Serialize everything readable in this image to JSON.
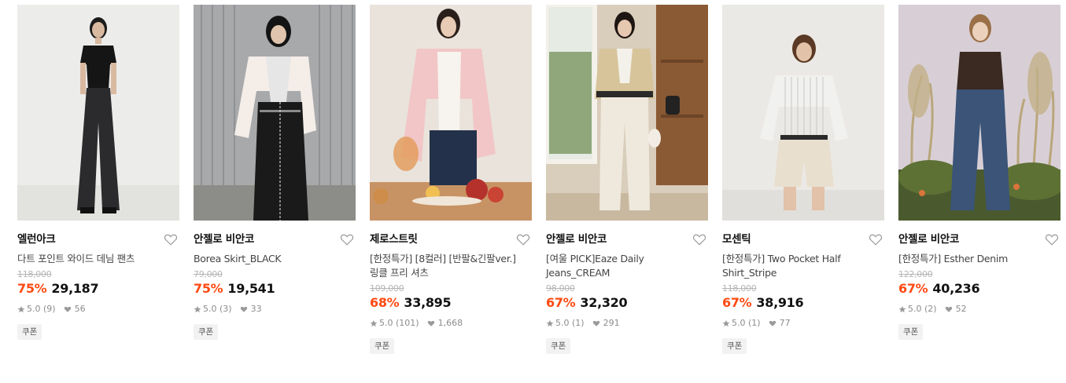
{
  "colors": {
    "discount": "#ff4a12",
    "price": "#111111",
    "muted": "#8c8c8c",
    "coupon_bg": "#f2f2f2"
  },
  "products": [
    {
      "brand": "엘런아크",
      "name": "다트 포인트 와이드 데님 팬츠",
      "original_price": "118,000",
      "discount": "75%",
      "price": "29,187",
      "rating": "5.0 (9)",
      "likes": "56",
      "badge": "쿠폰",
      "heart_icon": "heart-outline-icon"
    },
    {
      "brand": "안젤로 비안코",
      "name": "Borea Skirt_BLACK",
      "original_price": "79,000",
      "discount": "75%",
      "price": "19,541",
      "rating": "5.0 (3)",
      "likes": "33",
      "badge": "쿠폰",
      "heart_icon": "heart-outline-icon"
    },
    {
      "brand": "제로스트릿",
      "name": "[한정특가] [8컬러] [반팔&긴팔ver.] 링클 프리 셔츠",
      "original_price": "109,000",
      "discount": "68%",
      "price": "33,895",
      "rating": "5.0 (101)",
      "likes": "1,668",
      "badge": "쿠폰",
      "heart_icon": "heart-outline-icon"
    },
    {
      "brand": "안젤로 비안코",
      "name": "[여울 PICK]Eaze Daily Jeans_CREAM",
      "original_price": "98,000",
      "discount": "67%",
      "price": "32,320",
      "rating": "5.0 (1)",
      "likes": "291",
      "badge": "쿠폰",
      "heart_icon": "heart-outline-icon"
    },
    {
      "brand": "모센틱",
      "name": "[한정특가] Two Pocket Half Shirt_Stripe",
      "original_price": "118,000",
      "discount": "67%",
      "price": "38,916",
      "rating": "5.0 (1)",
      "likes": "77",
      "badge": "쿠폰",
      "heart_icon": "heart-outline-icon"
    },
    {
      "brand": "안젤로 비안코",
      "name": "[한정특가] Esther Denim",
      "original_price": "122,000",
      "discount": "67%",
      "price": "40,236",
      "rating": "5.0 (2)",
      "likes": "52",
      "badge": "쿠폰",
      "heart_icon": "heart-outline-icon"
    }
  ]
}
